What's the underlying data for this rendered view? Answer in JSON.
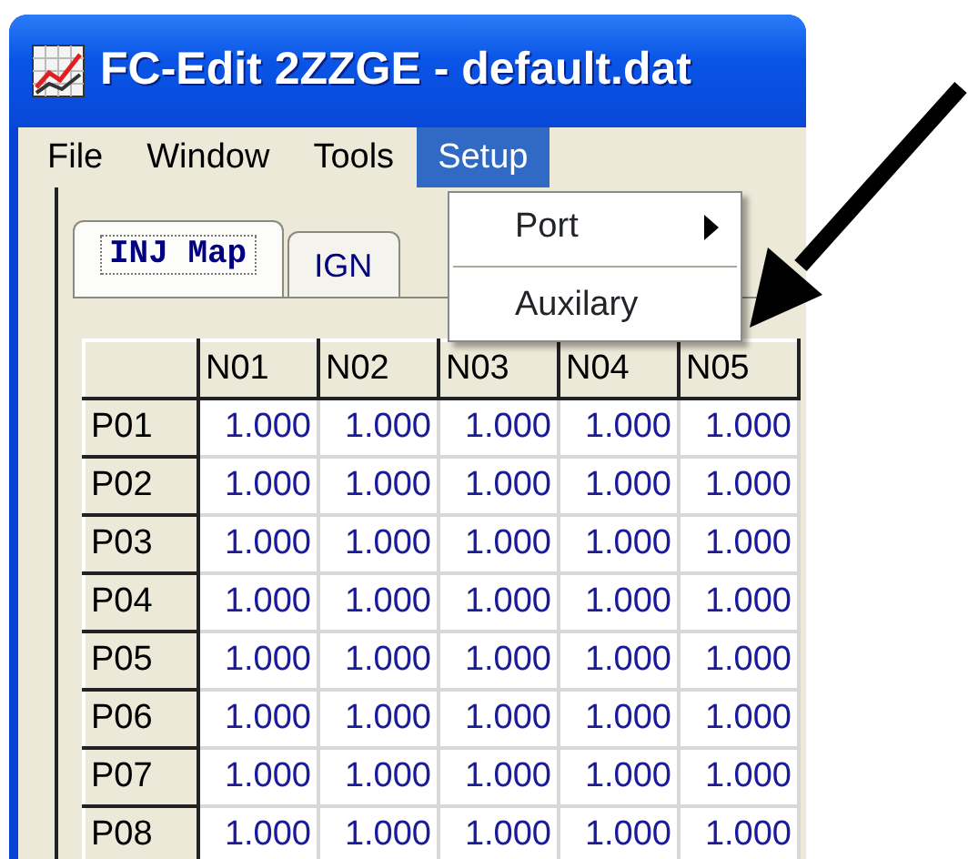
{
  "window": {
    "title": "FC-Edit 2ZZGE - default.dat"
  },
  "menu": [
    {
      "label": "File",
      "selected": false
    },
    {
      "label": "Window",
      "selected": false
    },
    {
      "label": "Tools",
      "selected": false
    },
    {
      "label": "Setup",
      "selected": true
    }
  ],
  "dropdown": [
    {
      "kind": "submenu",
      "label": "Port"
    },
    {
      "kind": "separator"
    },
    {
      "kind": "item",
      "label": "Auxilary"
    }
  ],
  "tabs": [
    {
      "label": "INJ Map",
      "selected": true
    },
    {
      "label": "IGN",
      "selected": false
    }
  ],
  "table": {
    "columns": [
      "N01",
      "N02",
      "N03",
      "N04",
      "N05"
    ],
    "rows": [
      {
        "header": "P01",
        "cells": [
          "1.000",
          "1.000",
          "1.000",
          "1.000",
          "1.000"
        ]
      },
      {
        "header": "P02",
        "cells": [
          "1.000",
          "1.000",
          "1.000",
          "1.000",
          "1.000"
        ]
      },
      {
        "header": "P03",
        "cells": [
          "1.000",
          "1.000",
          "1.000",
          "1.000",
          "1.000"
        ]
      },
      {
        "header": "P04",
        "cells": [
          "1.000",
          "1.000",
          "1.000",
          "1.000",
          "1.000"
        ]
      },
      {
        "header": "P05",
        "cells": [
          "1.000",
          "1.000",
          "1.000",
          "1.000",
          "1.000"
        ]
      },
      {
        "header": "P06",
        "cells": [
          "1.000",
          "1.000",
          "1.000",
          "1.000",
          "1.000"
        ]
      },
      {
        "header": "P07",
        "cells": [
          "1.000",
          "1.000",
          "1.000",
          "1.000",
          "1.000"
        ]
      },
      {
        "header": "P08",
        "cells": [
          "1.000",
          "1.000",
          "1.000",
          "1.000",
          "1.000"
        ]
      }
    ]
  }
}
